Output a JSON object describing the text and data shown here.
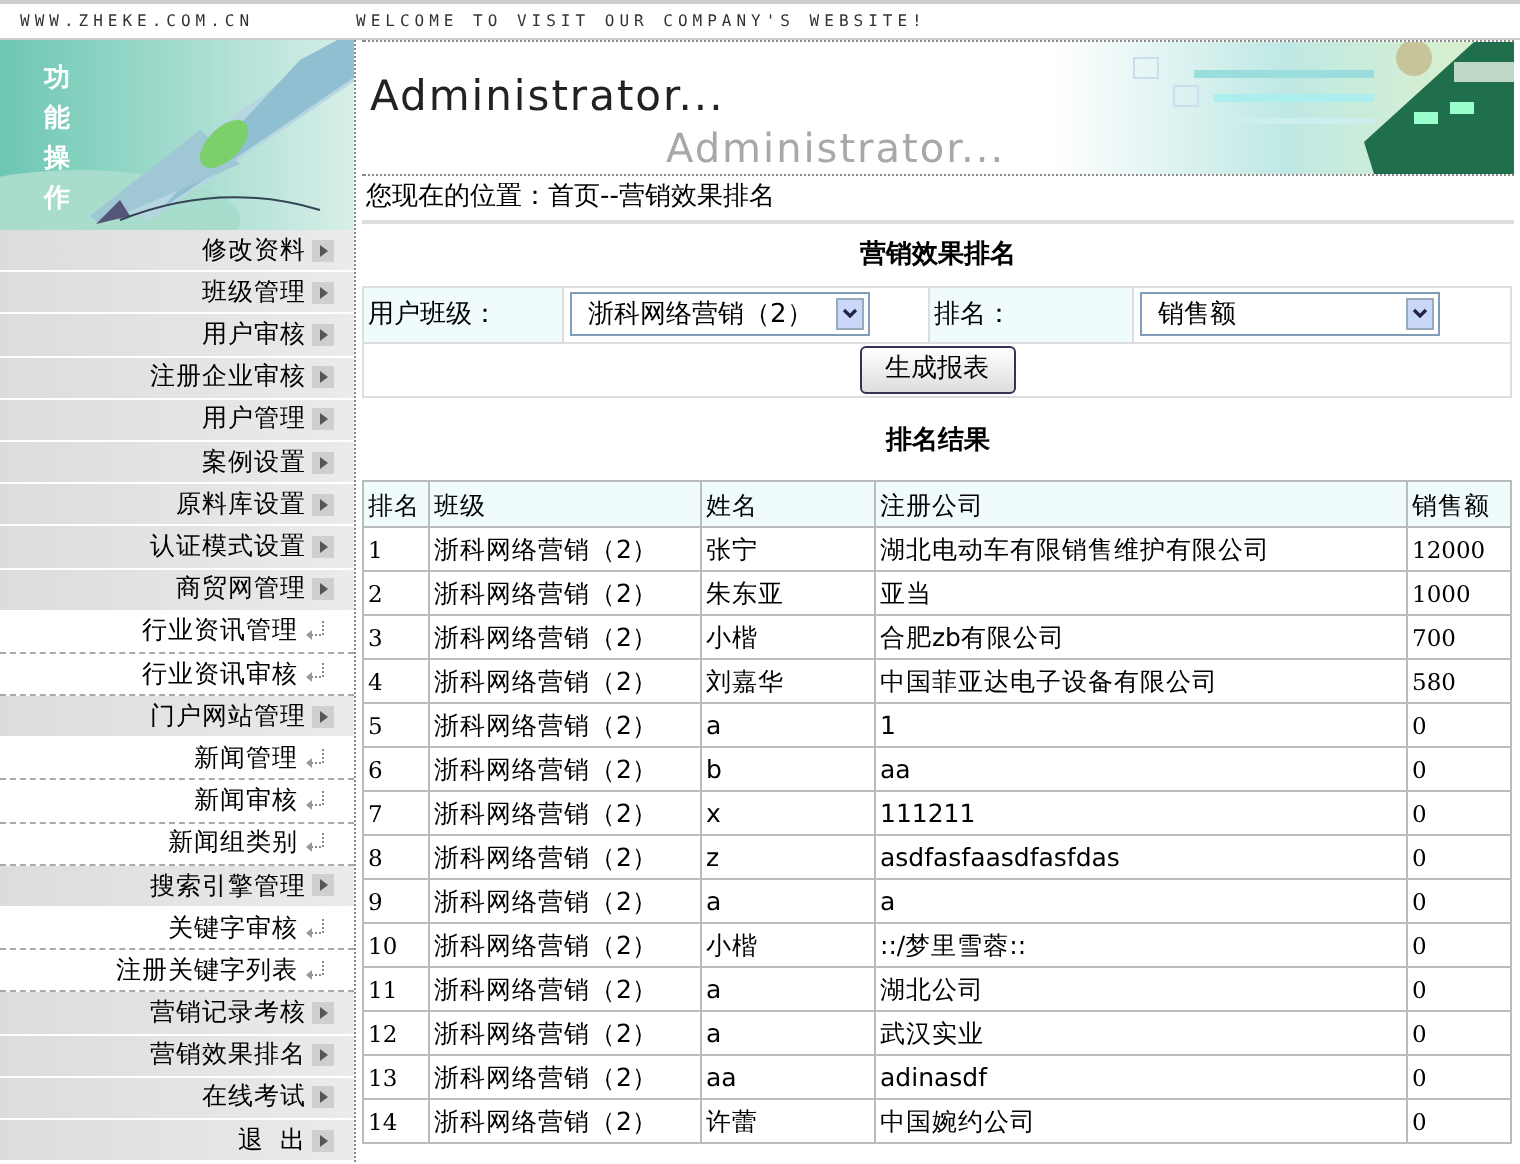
{
  "top_bar": {
    "site": "WWW.ZHEKE.COM.CN",
    "welcome": "WELCOME TO VISIT OUR COMPANY'S WEBSITE!"
  },
  "sidebar": {
    "banner_text": "功能操作",
    "items": [
      {
        "label": "修改资料",
        "kind": "section"
      },
      {
        "label": "班级管理",
        "kind": "section"
      },
      {
        "label": "用户审核",
        "kind": "section"
      },
      {
        "label": "注册企业审核",
        "kind": "section"
      },
      {
        "label": "用户管理",
        "kind": "section"
      },
      {
        "label": "案例设置",
        "kind": "section"
      },
      {
        "label": "原料库设置",
        "kind": "section"
      },
      {
        "label": "认证模式设置",
        "kind": "section"
      },
      {
        "label": "商贸网管理",
        "kind": "section"
      },
      {
        "label": "行业资讯管理",
        "kind": "link"
      },
      {
        "label": "行业资讯审核",
        "kind": "link"
      },
      {
        "label": "门户网站管理",
        "kind": "section"
      },
      {
        "label": "新闻管理",
        "kind": "link"
      },
      {
        "label": "新闻审核",
        "kind": "link"
      },
      {
        "label": "新闻组类别",
        "kind": "link"
      },
      {
        "label": "搜索引擎管理",
        "kind": "section"
      },
      {
        "label": "关键字审核",
        "kind": "link"
      },
      {
        "label": "注册关键字列表",
        "kind": "link"
      },
      {
        "label": "营销记录考核",
        "kind": "section"
      },
      {
        "label": "营销效果排名",
        "kind": "section"
      },
      {
        "label": "在线考试",
        "kind": "section"
      },
      {
        "label": "退  出",
        "kind": "section"
      }
    ]
  },
  "header": {
    "title": "Administrator...",
    "faded_title": "Administrator..."
  },
  "breadcrumb": "您现在的位置：首页--营销效果排名",
  "form": {
    "title": "营销效果排名",
    "class_label": "用户班级：",
    "class_value": "浙科网络营销（2）",
    "rank_label": "排名：",
    "rank_value": "销售额",
    "button": "生成报表"
  },
  "results": {
    "title": "排名结果",
    "columns": [
      "排名",
      "班级",
      "姓名",
      "注册公司",
      "销售额"
    ],
    "rows": [
      [
        "1",
        "浙科网络营销（2）",
        "张宁",
        "湖北电动车有限销售维护有限公司",
        "12000"
      ],
      [
        "2",
        "浙科网络营销（2）",
        "朱东亚",
        "亚当",
        "1000"
      ],
      [
        "3",
        "浙科网络营销（2）",
        "小楷",
        "合肥zb有限公司",
        "700"
      ],
      [
        "4",
        "浙科网络营销（2）",
        "刘嘉华",
        "中国菲亚达电子设备有限公司",
        "580"
      ],
      [
        "5",
        "浙科网络营销（2）",
        "a",
        "1",
        "0"
      ],
      [
        "6",
        "浙科网络营销（2）",
        "b",
        "aa",
        "0"
      ],
      [
        "7",
        "浙科网络营销（2）",
        "x",
        "111211",
        "0"
      ],
      [
        "8",
        "浙科网络营销（2）",
        "z",
        "asdfasfaasdfasfdas",
        "0"
      ],
      [
        "9",
        "浙科网络营销（2）",
        "a",
        "a",
        "0"
      ],
      [
        "10",
        "浙科网络营销（2）",
        "小楷",
        "::/梦里雪蓉::",
        "0"
      ],
      [
        "11",
        "浙科网络营销（2）",
        "a",
        "湖北公司",
        "0"
      ],
      [
        "12",
        "浙科网络营销（2）",
        "a",
        "武汉实业",
        "0"
      ],
      [
        "13",
        "浙科网络营销（2）",
        "aa",
        "adinasdf",
        "0"
      ],
      [
        "14",
        "浙科网络营销（2）",
        "许蕾",
        "中国婉约公司",
        "0"
      ]
    ]
  }
}
